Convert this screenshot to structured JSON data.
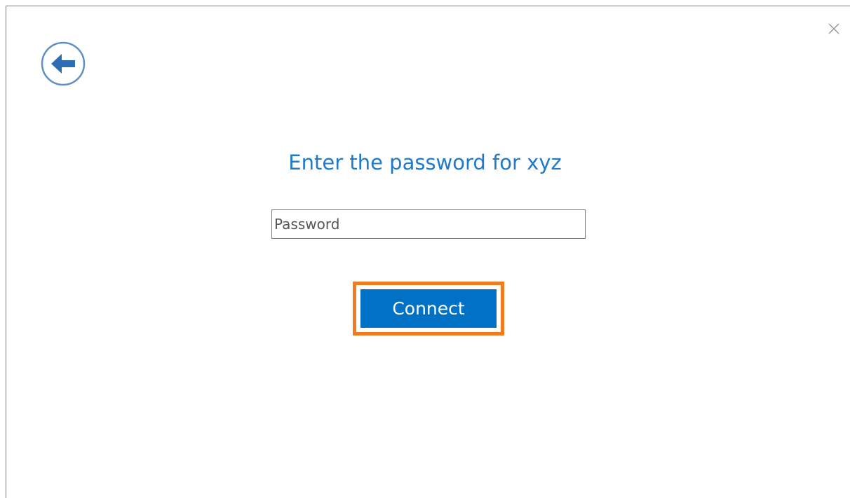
{
  "dialog": {
    "title": "Enter the password for xyz",
    "password_placeholder": "Password",
    "password_value": "",
    "connect_label": "Connect",
    "back_icon": "back-arrow-icon",
    "close_icon": "close-icon"
  },
  "colors": {
    "accent": "#1f7acc",
    "button": "#0071c5",
    "highlight": "#f07c22"
  }
}
